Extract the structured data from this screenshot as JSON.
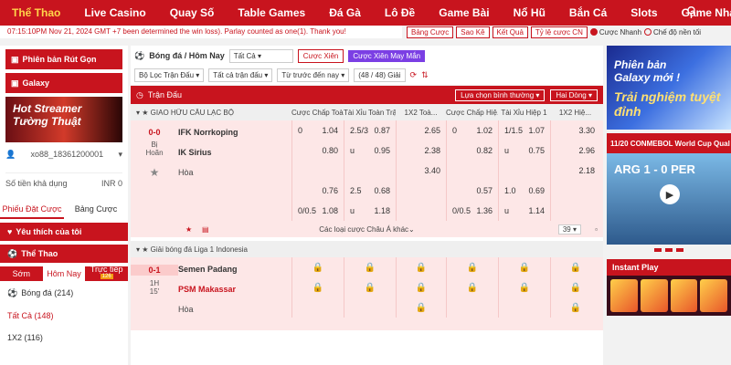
{
  "nav": {
    "items": [
      "Thể Thao",
      "Live Casino",
      "Quay Số",
      "Table Games",
      "Đá Gà",
      "Lô Đề",
      "Game Bài",
      "Nổ Hũ",
      "Bắn Cá",
      "Slots",
      "Game Nhanh"
    ],
    "active_index": 0
  },
  "ticker": "07:15:10PM Nov 21, 2024 GMT +7    been determined the win loss). Parlay counted as one(1). Thank you!",
  "toolbar": {
    "buttons": [
      "Bảng Cược",
      "Sao Kê",
      "Kết Quả",
      "Tỷ lệ cược CN"
    ],
    "radio1": "Cược Nhanh",
    "radio2": "Chế độ nền tối"
  },
  "left": {
    "promo1": "Phiên bản Rút Gọn",
    "promo2": "Galaxy",
    "promo3": "Hot Streamer Tường Thuật",
    "user": "xo88_18361200001",
    "balance_label": "Số tiền khả dụng",
    "balance_value": "INR 0",
    "tabs": [
      "Phiếu Đặt Cược",
      "Bảng Cược"
    ],
    "favorites": "Yêu thích của tôi",
    "sports": "Thể Thao",
    "sport_tabs": [
      "Sớm",
      "Hôm Nay",
      "Trực tiếp"
    ],
    "live_count": "126",
    "list": [
      "Bóng đá (214)",
      "Tất Cả (148)",
      "1X2 (116)"
    ]
  },
  "main": {
    "title": "Bóng đá / Hôm Nay",
    "filter_all": "Tất Cả",
    "btn_parlay": "Cược Xiên",
    "btn_lucky": "Cược Xiên May Mắn",
    "filter1": "Bộ Lọc Trận Đấu",
    "filter2": "Tất cả trận đấu",
    "filter3": "Từ trước đến nay",
    "count": "(48 / 48) Giải",
    "section": "Trận Đấu",
    "sort": "Lựa chọn bình thường",
    "view": "Hai Dòng",
    "col_headers": [
      "Cược Chấp Toà...",
      "Tài Xỉu Toàn Trận",
      "1X2 Toà...",
      "Cược Chấp Hiệ...",
      "Tài Xỉu Hiệp 1",
      "1X2 Hiệ..."
    ],
    "league1": "GIAO HỮU CÂU LẠC BỘ",
    "match1": {
      "score": "0-0",
      "status": "Bị Hoãn",
      "home": "IFK Norrkoping",
      "away": "IK Sirius",
      "draw": "Hòa",
      "rows": [
        [
          "0",
          "1.04",
          "2.5/3",
          "0.87",
          "",
          "2.65",
          "0",
          "1.02",
          "1/1.5",
          "1.07",
          "",
          "3.30"
        ],
        [
          "",
          "0.80",
          "u",
          "0.95",
          "",
          "2.38",
          "",
          "0.82",
          "u",
          "0.75",
          "",
          "2.96"
        ],
        [
          "",
          "",
          "",
          "",
          "",
          "3.40",
          "",
          "",
          "",
          "",
          "",
          "2.18"
        ],
        [
          "",
          "0.76",
          "2.5",
          "0.68",
          "",
          "",
          "",
          "0.57",
          "1.0",
          "0.69",
          "",
          ""
        ],
        [
          "0/0.5",
          "1.08",
          "u",
          "1.18",
          "",
          "",
          "0/0.5",
          "1.36",
          "u",
          "1.14",
          "",
          ""
        ]
      ],
      "more": "Các loại cược Châu Á khác",
      "markets": "39"
    },
    "league2": "Giải bóng đá Liga 1 Indonesia",
    "match2": {
      "score": "0-1",
      "status": "1H 15'",
      "home": "Semen Padang",
      "away": "PSM Makassar",
      "draw": "Hòa"
    }
  },
  "right": {
    "banner1_line1": "Phiên bản",
    "banner1_line2": "Galaxy mới !",
    "banner1_line3": "Trải nghiệm tuyệt đỉnh",
    "banner2": "11/20 CONMEBOL World Cup Qual",
    "teams": "ARG  1 - 0  PER",
    "instant": "Instant Play"
  }
}
